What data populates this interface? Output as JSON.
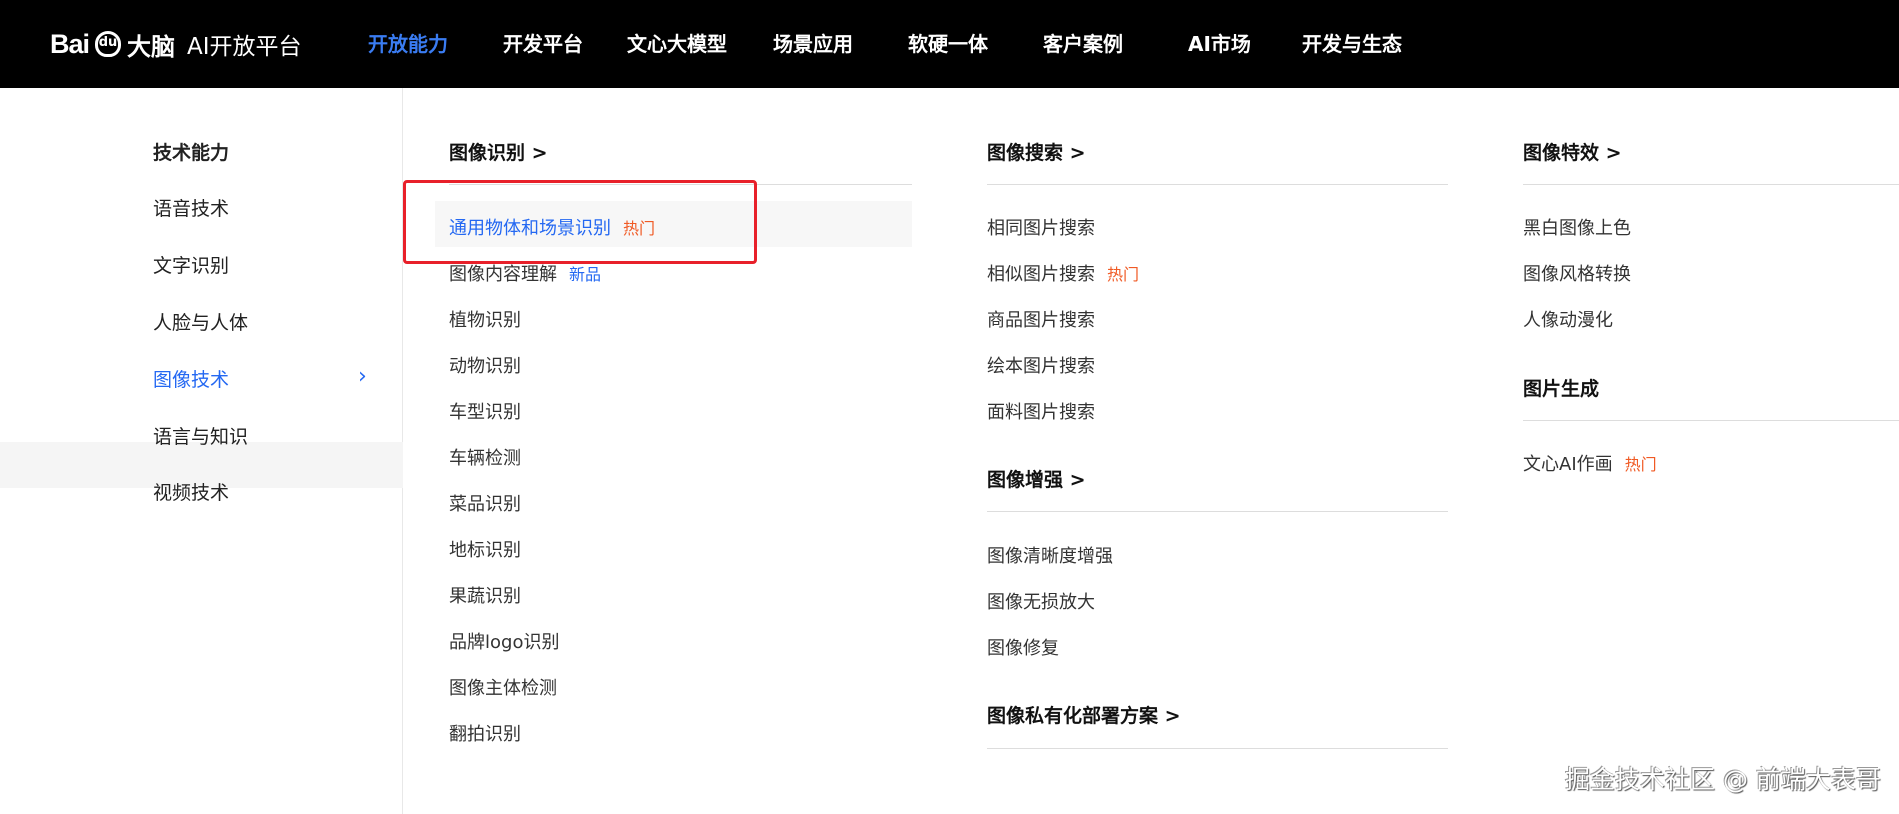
{
  "header": {
    "logo_brand": "Bai",
    "logo_paw": "du",
    "logo_name": "大脑",
    "platform": "AI开放平台",
    "nav": [
      "开放能力",
      "开发平台",
      "文心大模型",
      "场景应用",
      "软硬一体",
      "客户案例",
      "AI市场",
      "开发与生态"
    ],
    "active_nav": 0
  },
  "sidebar": {
    "title": "技术能力",
    "items": [
      "语音技术",
      "文字识别",
      "人脸与人体",
      "图像技术",
      "语言与知识",
      "视频技术"
    ],
    "selected": 3
  },
  "col1": {
    "heading": "图像识别 >",
    "items": [
      {
        "label": "通用物体和场景识别",
        "tag": "热门"
      },
      {
        "label": "图像内容理解",
        "tag": "新品"
      },
      {
        "label": "植物识别"
      },
      {
        "label": "动物识别"
      },
      {
        "label": "车型识别"
      },
      {
        "label": "车辆检测"
      },
      {
        "label": "菜品识别"
      },
      {
        "label": "地标识别"
      },
      {
        "label": "果蔬识别"
      },
      {
        "label": "品牌logo识别"
      },
      {
        "label": "图像主体检测"
      },
      {
        "label": "翻拍识别"
      }
    ]
  },
  "col2": {
    "search_heading": "图像搜索 >",
    "search_items": [
      {
        "label": "相同图片搜索"
      },
      {
        "label": "相似图片搜索",
        "tag": "热门"
      },
      {
        "label": "商品图片搜索"
      },
      {
        "label": "绘本图片搜索"
      },
      {
        "label": "面料图片搜索"
      }
    ],
    "enhance_heading": "图像增强 >",
    "enhance_items": [
      "图像清晰度增强",
      "图像无损放大",
      "图像修复"
    ],
    "private_heading": "图像私有化部署方案 >"
  },
  "col3": {
    "effects_heading": "图像特效 >",
    "effects_items": [
      "黑白图像上色",
      "图像风格转换",
      "人像动漫化"
    ],
    "gen_heading": "图片生成",
    "gen_items": [
      {
        "label": "文心AI作画",
        "tag": "热门"
      }
    ]
  },
  "watermark": "掘金技术社区 @ 前端大表哥",
  "colors": {
    "accent": "#2468f2",
    "hot": "#f05a24",
    "highlight_box": "#e8202a"
  }
}
